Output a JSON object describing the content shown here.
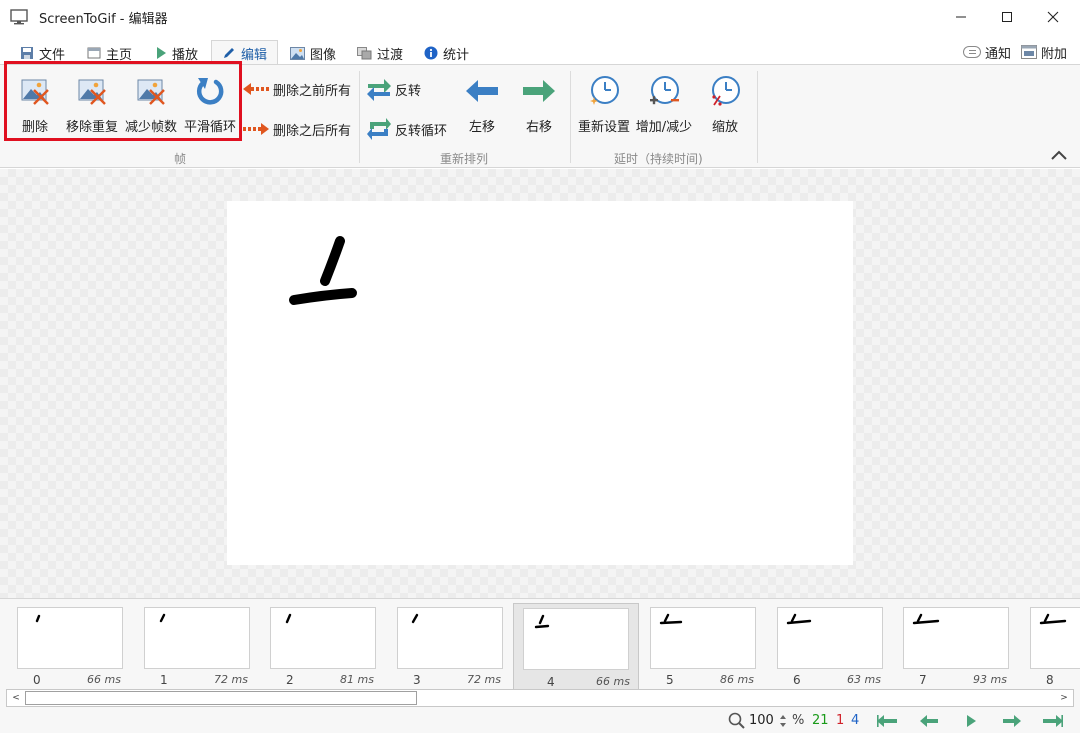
{
  "window": {
    "title": "ScreenToGif - 编辑器"
  },
  "tabs": [
    {
      "label": "文件",
      "icon": "save-icon",
      "active": false
    },
    {
      "label": "主页",
      "icon": "home-icon",
      "active": false
    },
    {
      "label": "播放",
      "icon": "play-icon",
      "active": false
    },
    {
      "label": "编辑",
      "icon": "pencil-icon",
      "active": true
    },
    {
      "label": "图像",
      "icon": "image-icon",
      "active": false
    },
    {
      "label": "过渡",
      "icon": "transition-icon",
      "active": false
    },
    {
      "label": "统计",
      "icon": "info-icon",
      "active": false
    }
  ],
  "right_tabs": [
    {
      "label": "通知",
      "icon": "notification-icon"
    },
    {
      "label": "附加",
      "icon": "extras-icon"
    }
  ],
  "ribbon": {
    "frames_group": {
      "label": "帧",
      "buttons": [
        {
          "label": "删除",
          "icon": "delete-frame-icon"
        },
        {
          "label": "移除重复",
          "icon": "remove-duplicates-icon"
        },
        {
          "label": "减少帧数",
          "icon": "reduce-frames-icon"
        },
        {
          "label": "平滑循环",
          "icon": "smooth-loop-icon"
        }
      ],
      "small_buttons": [
        {
          "label": "删除之前所有",
          "icon": "delete-previous-icon"
        },
        {
          "label": "删除之后所有",
          "icon": "delete-next-icon"
        }
      ]
    },
    "reorder_group": {
      "label": "重新排列",
      "small_buttons": [
        {
          "label": "反转",
          "icon": "reverse-icon"
        },
        {
          "label": "反转循环",
          "icon": "yoyo-icon"
        }
      ],
      "buttons": [
        {
          "label": "左移",
          "icon": "move-left-icon"
        },
        {
          "label": "右移",
          "icon": "move-right-icon"
        }
      ]
    },
    "delay_group": {
      "label": "延时（持续时间)",
      "buttons": [
        {
          "label": "重新设置",
          "icon": "override-delay-icon"
        },
        {
          "label": "增加/减少",
          "icon": "increase-decrease-delay-icon"
        },
        {
          "label": "缩放",
          "icon": "scale-delay-icon"
        }
      ]
    }
  },
  "timeline": {
    "frames": [
      {
        "index": "0",
        "duration": "66 ms"
      },
      {
        "index": "1",
        "duration": "72 ms"
      },
      {
        "index": "2",
        "duration": "81 ms"
      },
      {
        "index": "3",
        "duration": "72 ms"
      },
      {
        "index": "4",
        "duration": "66 ms",
        "selected": true
      },
      {
        "index": "5",
        "duration": "86 ms"
      },
      {
        "index": "6",
        "duration": "63 ms"
      },
      {
        "index": "7",
        "duration": "93 ms"
      },
      {
        "index": "8",
        "duration": ""
      }
    ],
    "scroll_left": "<",
    "scroll_right": ">"
  },
  "status": {
    "zoom": "100",
    "zoom_unit": "%",
    "frame_count": "21",
    "selected_count": "1",
    "current_frame": "4",
    "colors": {
      "count": "#1a9b1a",
      "selected": "#d0222a",
      "current": "#1f63c6"
    }
  },
  "colors": {
    "accent_blue": "#1f5fa8",
    "arrow_blue": "#3b7fc4",
    "arrow_green": "#4aa37a",
    "highlight_red": "#e01020",
    "orange": "#e0561f"
  }
}
